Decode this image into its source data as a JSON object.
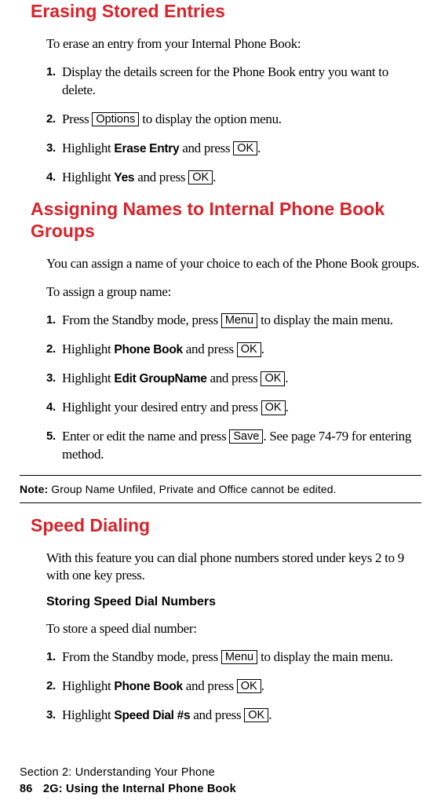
{
  "sec1": {
    "title": "Erasing Stored Entries",
    "intro": "To erase an entry from your Internal Phone Book:",
    "steps": [
      {
        "n": "1.",
        "pre": "Display the details screen for the Phone Book entry you want to delete."
      },
      {
        "n": "2.",
        "pre": "Press ",
        "key": "Options",
        "post": " to display the option menu."
      },
      {
        "n": "3.",
        "pre": "Highlight ",
        "bold": "Erase Entry",
        "mid": " and press ",
        "key": "OK",
        "post": "."
      },
      {
        "n": "4.",
        "pre": "Highlight ",
        "bold": "Yes",
        "mid": " and press ",
        "key": "OK",
        "post": "."
      }
    ]
  },
  "sec2": {
    "title": "Assigning Names to Internal Phone Book Groups",
    "intro1": "You can assign a name of your choice to each of the Phone Book groups.",
    "intro2": "To assign a group name:",
    "steps": [
      {
        "n": "1.",
        "pre": "From the Standby mode, press ",
        "key": "Menu",
        "post": " to display the main menu."
      },
      {
        "n": "2.",
        "pre": "Highlight ",
        "bold": "Phone Book",
        "mid": " and press ",
        "key": "OK",
        "post": "."
      },
      {
        "n": "3.",
        "pre": "Highlight ",
        "bold": "Edit GroupName",
        "mid": " and press ",
        "key": "OK",
        "post": "."
      },
      {
        "n": "4.",
        "pre": "Highlight your desired entry and press ",
        "key": "OK",
        "post": "."
      },
      {
        "n": "5.",
        "pre": "Enter or edit the name and press ",
        "key": "Save",
        "post": ". See page 74-79 for entering method."
      }
    ]
  },
  "note": {
    "label": "Note:",
    "text": " Group Name Unfiled, Private and Office cannot be edited."
  },
  "sec3": {
    "title": "Speed Dialing",
    "intro": "With this feature you can dial phone numbers stored under keys 2 to 9 with one key press.",
    "subhead": "Storing Speed Dial Numbers",
    "intro2": "To store a speed dial number:",
    "steps": [
      {
        "n": "1.",
        "pre": "From the Standby mode, press ",
        "key": "Menu",
        "post": " to display the main menu."
      },
      {
        "n": "2.",
        "pre": "Highlight ",
        "bold": "Phone Book",
        "mid": " and press ",
        "key": "OK",
        "post": "."
      },
      {
        "n": "3.",
        "pre": "Highlight ",
        "bold": "Speed Dial #s",
        "mid": " and press ",
        "key": "OK",
        "post": "."
      }
    ]
  },
  "footer": {
    "line1": "Section 2: Understanding Your Phone",
    "pagenum": "86",
    "line2": "2G: Using the Internal Phone Book"
  }
}
